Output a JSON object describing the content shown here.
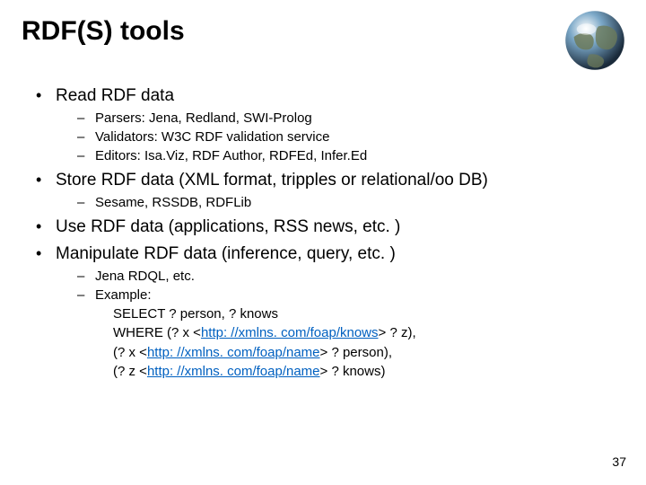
{
  "title": "RDF(S) tools",
  "bullets": {
    "b1_1": "Read RDF data",
    "b2_1": "Parsers: Jena, Redland, SWI-Prolog",
    "b2_2": "Validators: W3C RDF validation service",
    "b2_3": "Editors: Isa.Viz, RDF Author, RDFEd, Infer.Ed",
    "b1_2": "Store RDF data (XML format, tripples or relational/oo DB)",
    "b2_4": "Sesame, RSSDB, RDFLib",
    "b1_3": "Use RDF data (applications, RSS news, etc. )",
    "b1_4": "Manipulate RDF data (inference, query, etc. )",
    "b2_5": "Jena RDQL, etc.",
    "b2_6": "Example:",
    "ex_1": "SELECT ? person, ? knows",
    "ex_2a": "WHERE (? x <",
    "ex_2link": "http: //xmlns. com/foap/knows",
    "ex_2b": "> ? z),",
    "ex_3a": "(? x <",
    "ex_3link": "http: //xmlns. com/foap/name",
    "ex_3b": "> ? person),",
    "ex_4a": "(? z <",
    "ex_4link": "http: //xmlns. com/foap/name",
    "ex_4b": "> ? knows)"
  },
  "page_number": "37"
}
